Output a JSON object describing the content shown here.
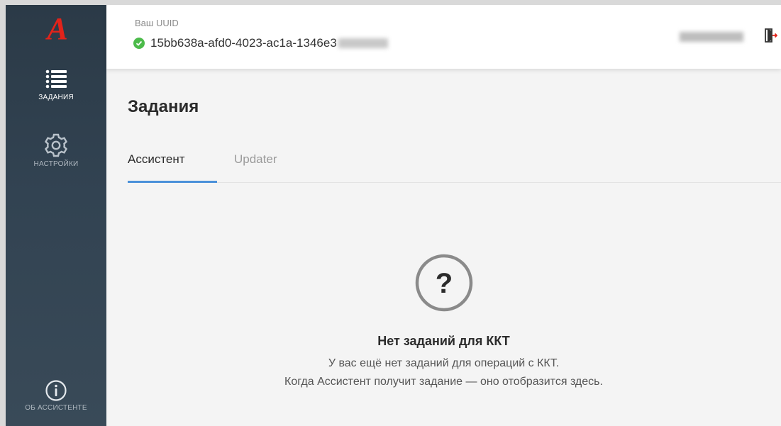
{
  "sidebar": {
    "logo": "A",
    "items": [
      {
        "label": "ЗАДАНИЯ",
        "icon": "list-icon"
      },
      {
        "label": "НАСТРОЙКИ",
        "icon": "gear-icon"
      }
    ],
    "about": {
      "label": "ОБ АССИСТЕНТЕ",
      "icon": "info-icon"
    }
  },
  "header": {
    "uuid_label": "Ваш UUID",
    "uuid_value": "15bb638a-afd0-4023-ac1a-1346e3",
    "status_color": "#4cbb4a"
  },
  "main": {
    "title": "Задания",
    "tabs": [
      {
        "label": "Ассистент",
        "active": true
      },
      {
        "label": "Updater",
        "active": false
      }
    ],
    "empty": {
      "title": "Нет заданий для ККТ",
      "line1": "У вас ещё нет заданий для операций с ККТ.",
      "line2": "Когда Ассистент получит задание — оно отобразится здесь."
    }
  },
  "colors": {
    "accent": "#4a90d9",
    "brand": "#e2231a",
    "sidebar": "#2b3a47"
  }
}
